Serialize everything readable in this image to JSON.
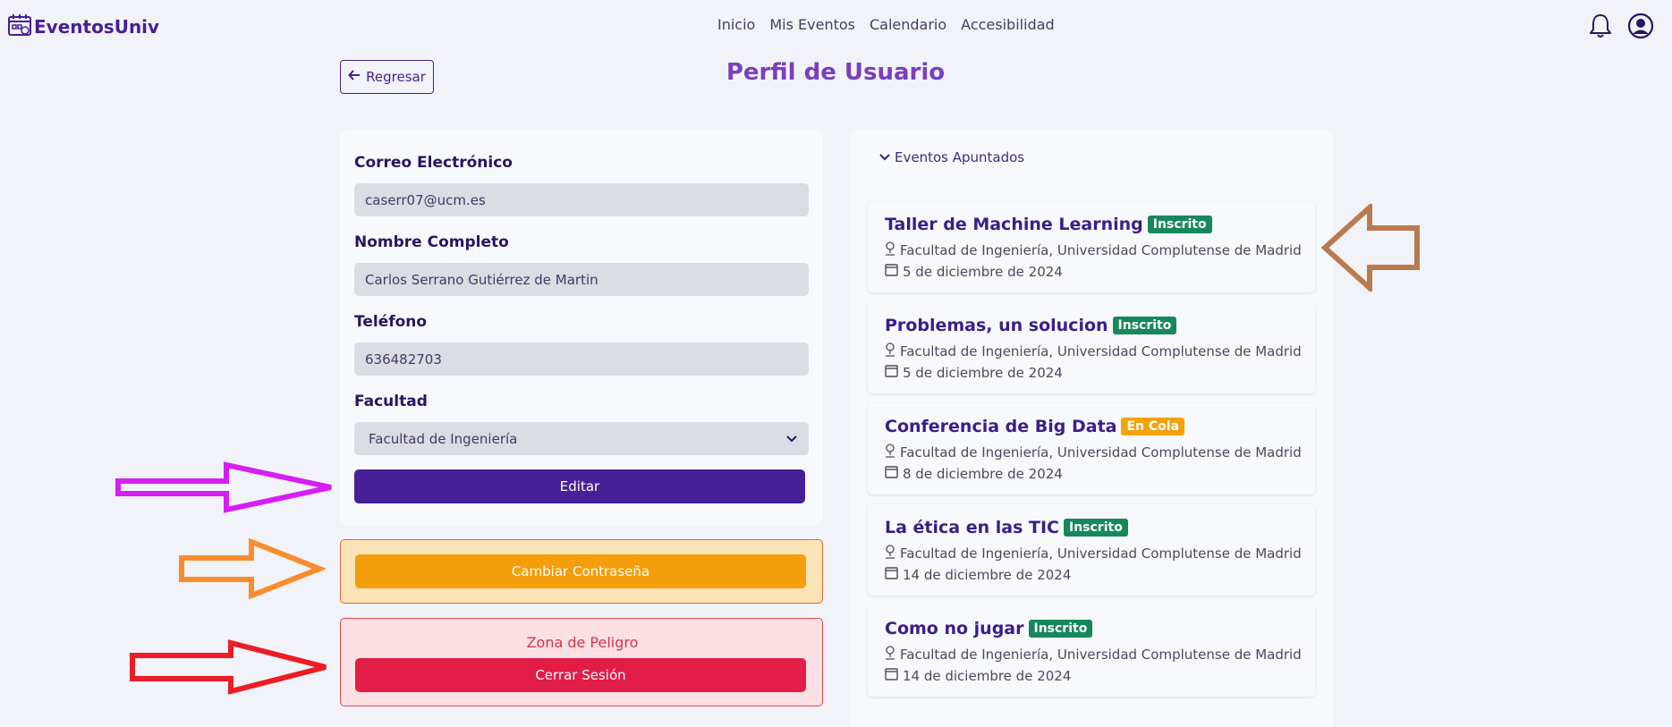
{
  "nav": {
    "brand": "EventosUniv",
    "links": [
      "Inicio",
      "Mis Eventos",
      "Calendario",
      "Accesibilidad"
    ],
    "icons": [
      "bell-icon",
      "user-circle-icon"
    ]
  },
  "header": {
    "back_label": "Regresar",
    "title": "Perfil de Usuario"
  },
  "profile": {
    "email_label": "Correo Electrónico",
    "email_value": "caserr07@ucm.es",
    "name_label": "Nombre Completo",
    "name_value": "Carlos Serrano Gutiérrez de Martin",
    "phone_label": "Teléfono",
    "phone_value": "636482703",
    "faculty_label": "Facultad",
    "faculty_value": "Facultad de Ingeniería",
    "edit_label": "Editar"
  },
  "password": {
    "button_label": "Cambiar Contraseña"
  },
  "danger": {
    "title": "Zona de Peligro",
    "logout_label": "Cerrar Sesión"
  },
  "events": {
    "toggle_label": "Eventos Apuntados",
    "items": [
      {
        "title": "Taller de Machine Learning",
        "status": "Inscrito",
        "location": "Facultad de Ingeniería, Universidad Complutense de Madrid",
        "date": "5 de diciembre de 2024"
      },
      {
        "title": "Problemas, un solucion",
        "status": "Inscrito",
        "location": "Facultad de Ingeniería, Universidad Complutense de Madrid",
        "date": "5 de diciembre de 2024"
      },
      {
        "title": "Conferencia de Big Data",
        "status": "En Cola",
        "location": "Facultad de Ingeniería, Universidad Complutense de Madrid",
        "date": "8 de diciembre de 2024"
      },
      {
        "title": "La ética en las TIC",
        "status": "Inscrito",
        "location": "Facultad de Ingeniería, Universidad Complutense de Madrid",
        "date": "14 de diciembre de 2024"
      },
      {
        "title": "Como no jugar",
        "status": "Inscrito",
        "location": "Facultad de Ingeniería, Universidad Complutense de Madrid",
        "date": "14 de diciembre de 2024"
      }
    ]
  },
  "colors": {
    "primary": "#471f96",
    "title_purple": "#7b3fbe",
    "warning": "#f59e0b",
    "danger": "#e11d48",
    "badge_green": "#16885c",
    "badge_orange": "#f5a20b",
    "arrow_magenta": "#d61ef5",
    "arrow_orange": "#fb8c2e",
    "arrow_red": "#ee1c24",
    "arrow_brown": "#b97a4f"
  }
}
